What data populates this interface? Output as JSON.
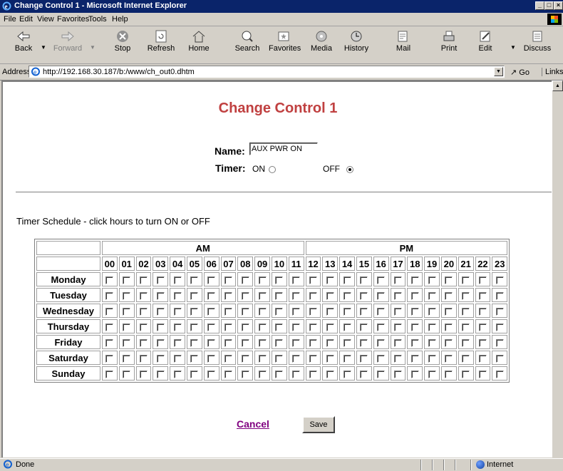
{
  "window": {
    "title": "Change Control 1 - Microsoft Internet Explorer"
  },
  "menu": [
    "File",
    "Edit",
    "View",
    "Favorites",
    "Tools",
    "Help"
  ],
  "toolbar": {
    "back": "Back",
    "forward": "Forward",
    "stop": "Stop",
    "refresh": "Refresh",
    "home": "Home",
    "search": "Search",
    "favorites": "Favorites",
    "media": "Media",
    "history": "History",
    "mail": "Mail",
    "print": "Print",
    "edit": "Edit",
    "discuss": "Discuss"
  },
  "address": {
    "label": "Address",
    "url": "http://192.168.30.187/b:/www/ch_out0.dhtm",
    "go": "Go",
    "links": "Links"
  },
  "page": {
    "heading": "Change Control 1",
    "name_label": "Name:",
    "name_value": "AUX PWR ON",
    "timer_label": "Timer:",
    "on_label": "ON",
    "off_label": "OFF",
    "timer_selected": "OFF",
    "schedule_text": "Timer Schedule - click hours to turn ON or OFF",
    "am_label": "AM",
    "pm_label": "PM",
    "hours": [
      "00",
      "01",
      "02",
      "03",
      "04",
      "05",
      "06",
      "07",
      "08",
      "09",
      "10",
      "11",
      "12",
      "13",
      "14",
      "15",
      "16",
      "17",
      "18",
      "19",
      "20",
      "21",
      "22",
      "23"
    ],
    "days": [
      "Monday",
      "Tuesday",
      "Wednesday",
      "Thursday",
      "Friday",
      "Saturday",
      "Sunday"
    ],
    "cancel_label": "Cancel",
    "save_label": "Save"
  },
  "status": {
    "text": "Done",
    "zone": "Internet"
  },
  "colors": {
    "heading": "#c04040",
    "titlebar": "#0a246a",
    "link_visited": "#800080"
  }
}
